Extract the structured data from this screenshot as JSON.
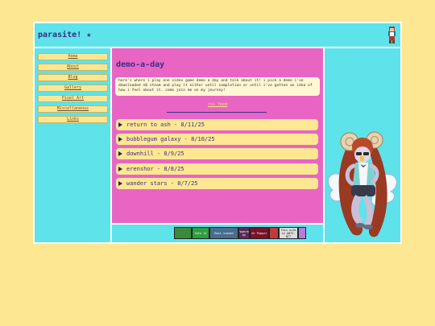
{
  "site": {
    "title": "parasite! ★"
  },
  "nav": [
    {
      "label": "Home"
    },
    {
      "label": "About"
    },
    {
      "label": "Blog"
    },
    {
      "label": "Gallery"
    },
    {
      "label": "Pixel Art"
    },
    {
      "label": "Miscellaneous"
    },
    {
      "label": "Links"
    }
  ],
  "main": {
    "title": "demo-a-day",
    "intro": "here's where i play one video game demo a day and talk about it! i pick a demo i've downloaded n0 steam and play it either until completion or until i've gotten an idea of how i feel about it. come join me on my journey!",
    "rss_label": "rss feed",
    "posts": [
      {
        "label": "return to ash - 8/11/25"
      },
      {
        "label": "bubblegum galaxy - 8/10/25"
      },
      {
        "label": "downhill - 8/9/25"
      },
      {
        "label": "erenshor - 8/8/25"
      },
      {
        "label": "wander stars - 8/7/25"
      }
    ]
  },
  "badges": [
    {
      "text": "",
      "color": "#3b8a3b"
    },
    {
      "text": "Vote 14",
      "color": "#2f9e3e"
    },
    {
      "text": "Best viewed",
      "color": "#4a6d8c"
    },
    {
      "text": "Powered by",
      "color": "#5b2b55"
    },
    {
      "text": "Dr Pepper",
      "color": "#7a1228"
    },
    {
      "text": "",
      "color": "#c23a3a"
    },
    {
      "text": "This site is ANTI-NFT",
      "color": "#dddddd"
    },
    {
      "text": "",
      "color": "#b57edc"
    }
  ],
  "colors": {
    "bg": "#fee793",
    "cyan": "#5ee3ea",
    "pink": "#e965c4",
    "navy": "#3a2f86"
  },
  "icons": {
    "header_avatar": "pixel-character-icon",
    "mascot": "winged-character-illustration"
  }
}
